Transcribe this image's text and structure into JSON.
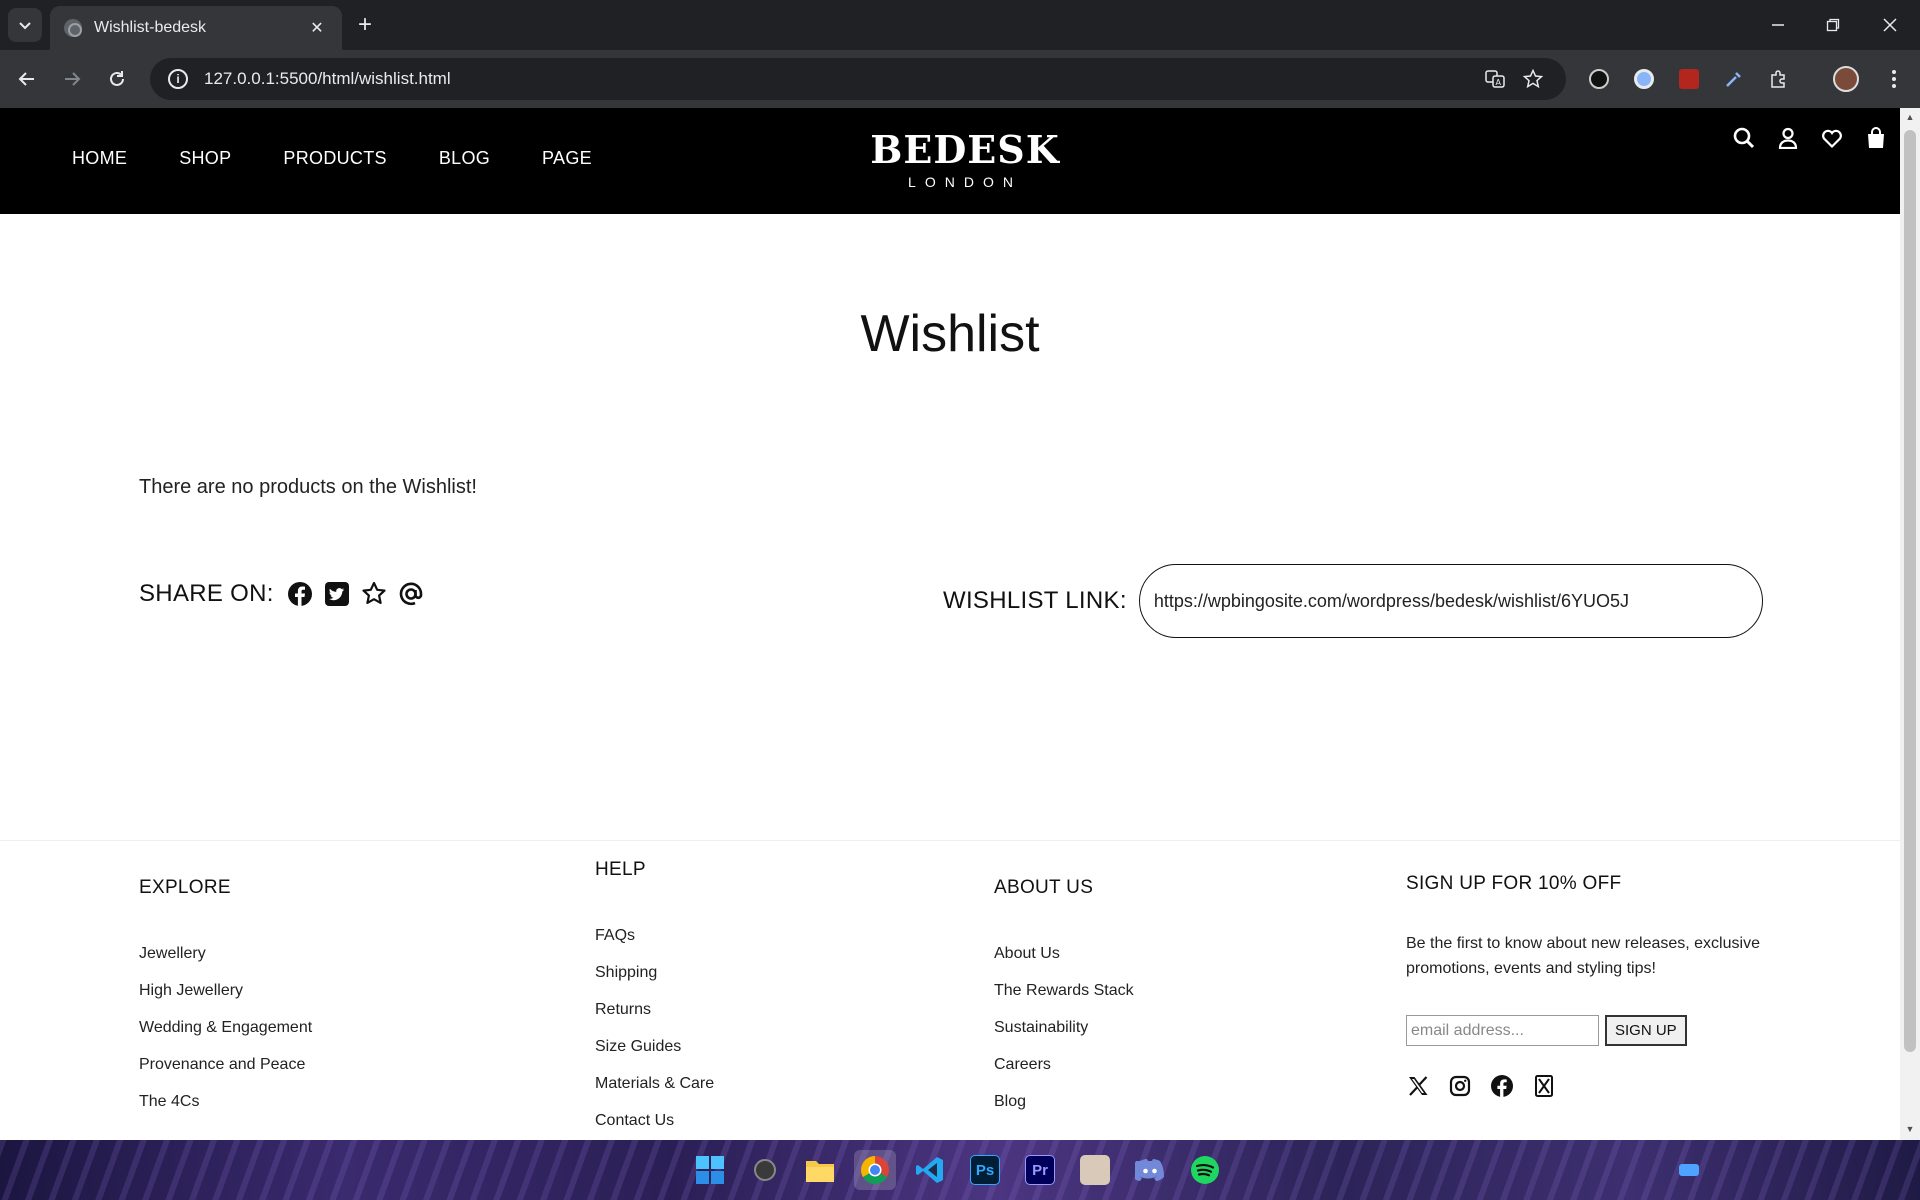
{
  "browser": {
    "tab_title": "Wishlist-bedesk",
    "url": "127.0.0.1:5500/html/wishlist.html"
  },
  "site": {
    "nav": [
      "HOME",
      "SHOP",
      "PRODUCTS",
      "BLOG",
      "PAGE"
    ],
    "logo_main": "BEDESK",
    "logo_sub": "LONDON"
  },
  "wishlist": {
    "title": "Wishlist",
    "empty_message": "There are no products on the Wishlist!",
    "share_label": "SHARE ON:",
    "link_label": "WISHLIST LINK:",
    "link_value": "https://wpbingosite.com/wordpress/bedesk/wishlist/6YUO5J"
  },
  "footer": {
    "explore": {
      "title": "EXPLORE",
      "items": [
        "Jewellery",
        "High Jewellery",
        "Wedding & Engagement",
        "Provenance and Peace",
        "The 4Cs"
      ]
    },
    "help": {
      "title": "HELP",
      "items": [
        "FAQs",
        "Shipping",
        "Returns",
        "Size Guides",
        "Materials & Care",
        "Contact Us"
      ]
    },
    "about": {
      "title": "ABOUT US",
      "items": [
        "About Us",
        "The Rewards Stack",
        "Sustainability",
        "Careers",
        "Blog"
      ]
    },
    "signup": {
      "title": "SIGN UP FOR 10% OFF",
      "text": "Be the first to know about new releases, exclusive promotions, events and styling tips!",
      "placeholder": "email address...",
      "button": "SIGN UP"
    }
  },
  "taskbar_apps": [
    "windows-start",
    "search",
    "file-explorer",
    "chrome",
    "vscode",
    "photoshop",
    "premiere",
    "game",
    "discord",
    "spotify"
  ]
}
